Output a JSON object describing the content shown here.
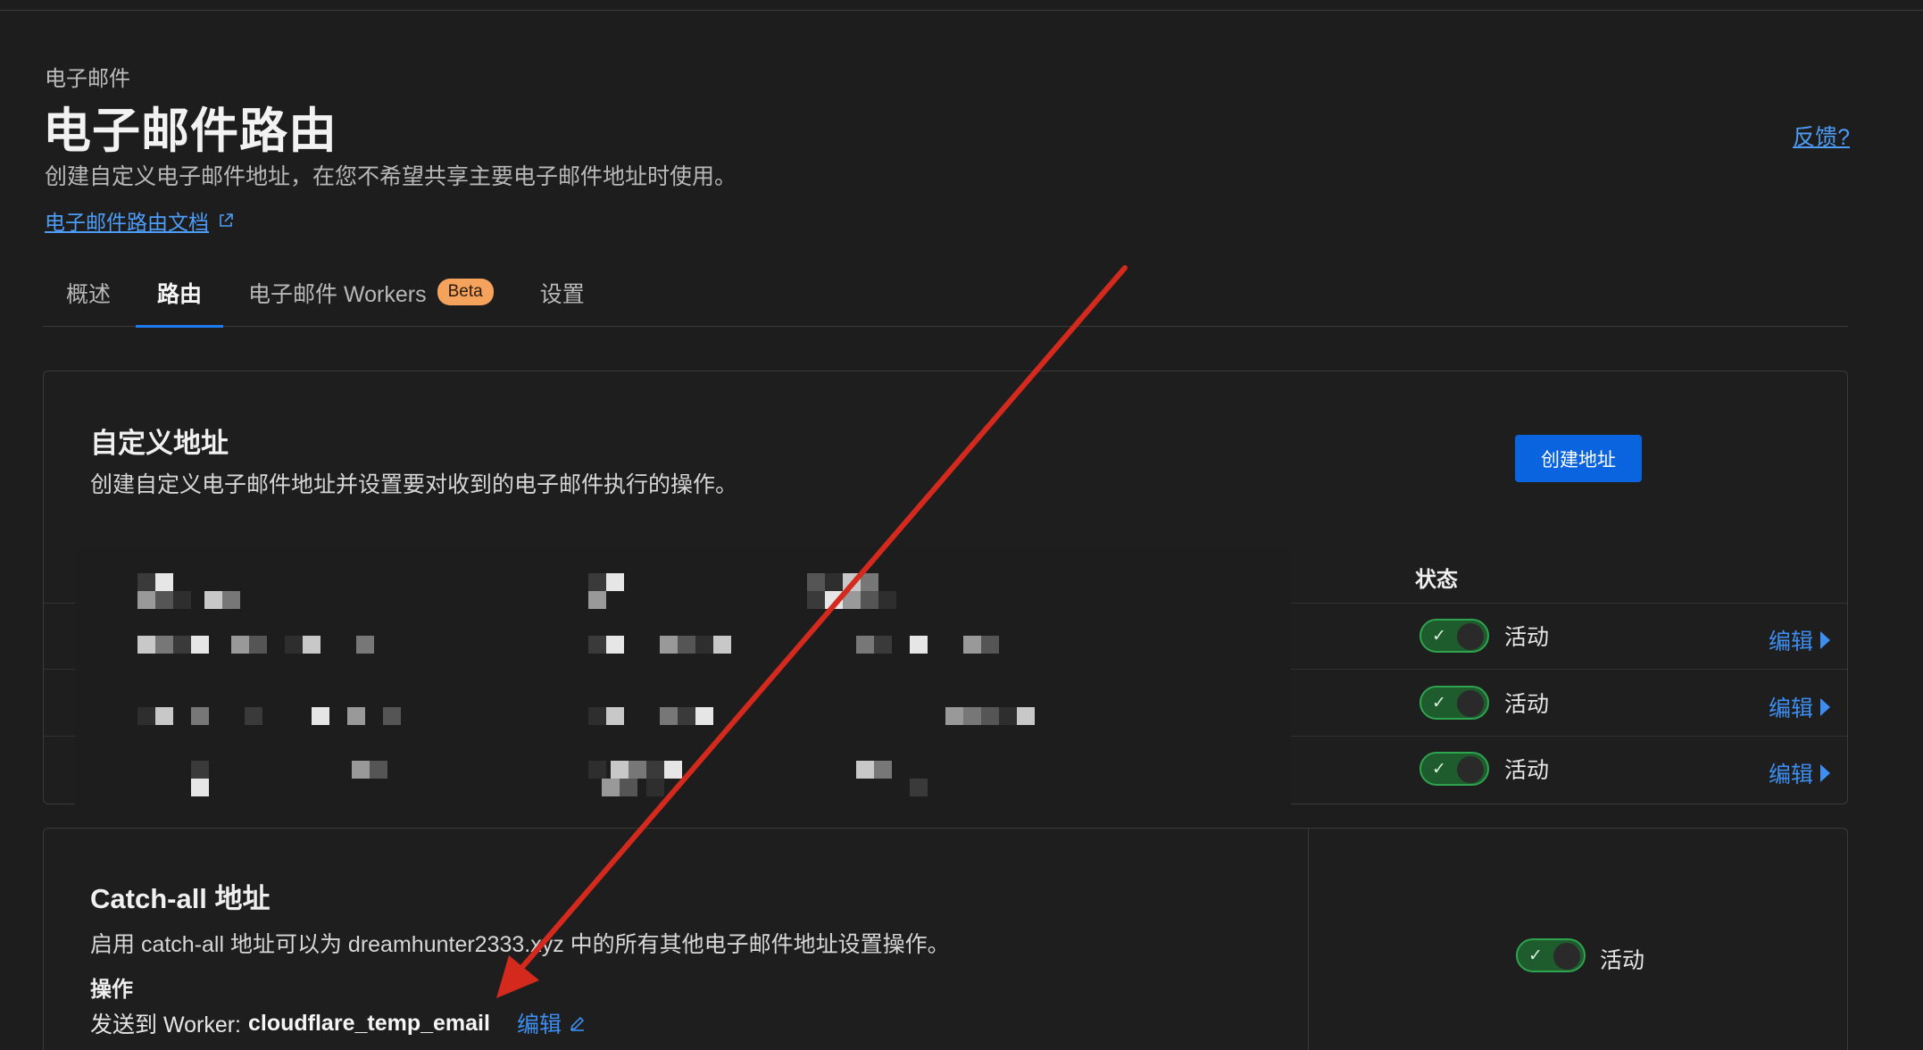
{
  "header": {
    "breadcrumb": "电子邮件",
    "title": "电子邮件路由",
    "description": "创建自定义电子邮件地址，在您不希望共享主要电子邮件地址时使用。",
    "docs_link": "电子邮件路由文档",
    "feedback": "反馈?"
  },
  "tabs": [
    {
      "label": "概述",
      "active": false
    },
    {
      "label": "路由",
      "active": true
    },
    {
      "label": "电子邮件 Workers",
      "badge": "Beta",
      "active": false
    },
    {
      "label": "设置",
      "active": false
    }
  ],
  "custom_addresses": {
    "title": "自定义地址",
    "description": "创建自定义电子邮件地址并设置要对收到的电子邮件执行的操作。",
    "create_button": "创建地址",
    "status_header": "状态",
    "rows": [
      {
        "status": "活动",
        "enabled": true,
        "edit": "编辑"
      },
      {
        "status": "活动",
        "enabled": true,
        "edit": "编辑"
      },
      {
        "status": "活动",
        "enabled": true,
        "edit": "编辑"
      }
    ]
  },
  "catch_all": {
    "title": "Catch-all 地址",
    "description": "启用 catch-all 地址可以为 dreamhunter2333.xyz 中的所有其他电子邮件地址设置操作。",
    "action_label": "操作",
    "action_prefix": "发送到 Worker: ",
    "worker_name": "cloudflare_temp_email",
    "edit": "编辑",
    "status": "活动",
    "enabled": true
  },
  "colors": {
    "accent": "#0a63df",
    "link": "#3d8ef0",
    "toggle_on": "#2ea44f",
    "badge": "#f5a35c",
    "annotation_arrow": "#d42a1e"
  }
}
